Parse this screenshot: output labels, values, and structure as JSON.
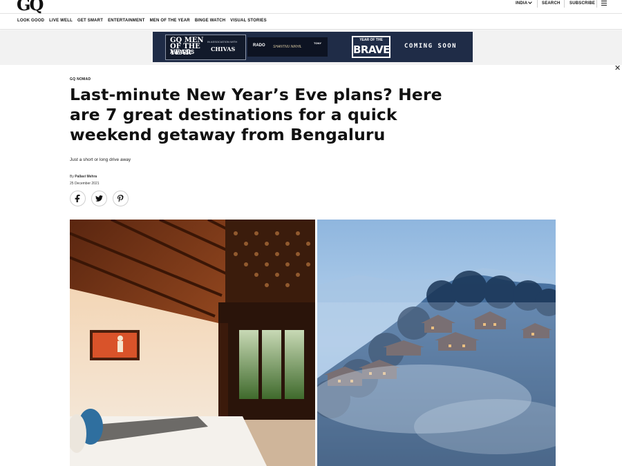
{
  "header": {
    "logo": "GQ",
    "region": "INDIA",
    "search_label": "SEARCH",
    "subscribe_label": "SUBSCRIBE",
    "icons": {
      "region_dropdown": "chevron-down-icon",
      "menu": "hamburger-menu-icon",
      "close_ad": "close-icon"
    }
  },
  "nav": {
    "items": [
      "LOOK GOOD",
      "LIVE WELL",
      "GET SMART",
      "ENTERTAINMENT",
      "MEN OF THE YEAR",
      "BINGE WATCH",
      "VISUAL STORIES"
    ]
  },
  "ad": {
    "gq_text": "GQ MEN OF THE YEAR",
    "awards_text": "AWARDS",
    "assoc_text": "IN ASSOCIATION WITH",
    "chivas_text": "CHIVAS",
    "rado_text": "RADO",
    "shantanu_text": "SHANTNU NIKHIL",
    "tony_text": "TONY",
    "year_of_text": "YEAR OF THE",
    "brave_text": "BRAVE",
    "coming_soon_text": "COMING SOON",
    "colors": {
      "background": "#1f2c47",
      "text": "#ffffff"
    }
  },
  "article": {
    "rubric": "GQ NOMAD",
    "headline": "Last-minute New Year’s Eve plans? Here are 7 great destinations for a quick weekend getaway from Bengaluru",
    "dek": "Just a short or long drive away",
    "byline_prefix": "By",
    "author": "Pallavi Mehra",
    "date": "25 December 2021",
    "share_icons": [
      "facebook-icon",
      "twitter-icon",
      "pinterest-icon"
    ]
  }
}
